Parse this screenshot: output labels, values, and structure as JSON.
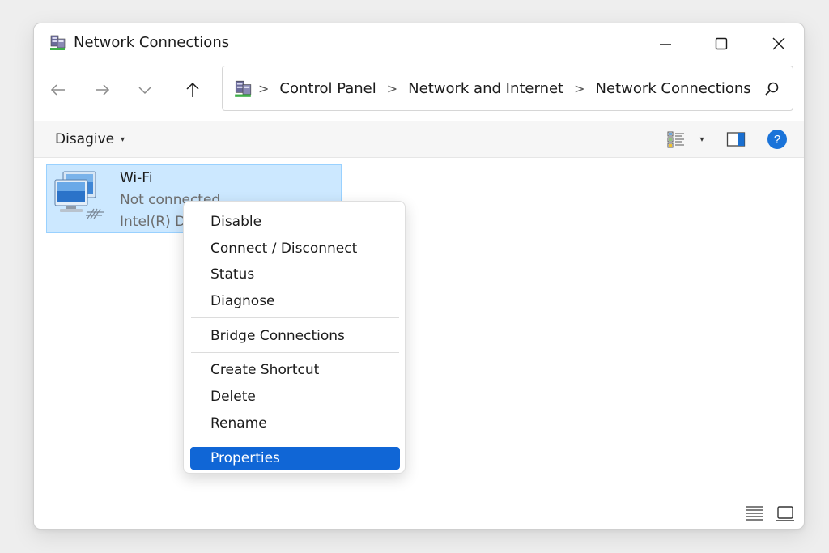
{
  "window": {
    "title": "Network Connections"
  },
  "address_bar": {
    "crumbs": [
      "Control Panel",
      "Network and Internet",
      "Network Connections"
    ],
    "separator": ">"
  },
  "command_bar": {
    "organize_label": "Disagive",
    "caret": "▾"
  },
  "connection": {
    "name": "Wi-Fi",
    "status": "Not connected",
    "device": "Intel(R) D"
  },
  "context_menu": {
    "items": [
      "Disable",
      "Connect / Disconnect",
      "Status",
      "Diagnose",
      "Bridge Connections",
      "Create Shortcut",
      "Delete",
      "Rename",
      "Properties"
    ],
    "highlighted": "Properties"
  },
  "icons": {
    "title": "network-connections-icon",
    "back": "arrow-left-icon",
    "forward": "arrow-right-icon",
    "recent": "chevron-down-icon",
    "up": "arrow-up-icon",
    "search": "search-icon",
    "view": "change-view-icon",
    "preview_pane": "preview-pane-icon",
    "help": "help-icon",
    "details_view": "details-view-icon",
    "tiles_view": "large-icons-view-icon"
  },
  "colors": {
    "selection_bg": "#cce8ff",
    "selection_border": "#99d1ff",
    "menu_highlight": "#1066d6",
    "help_blue": "#1a73d9"
  },
  "help_glyph": "?"
}
